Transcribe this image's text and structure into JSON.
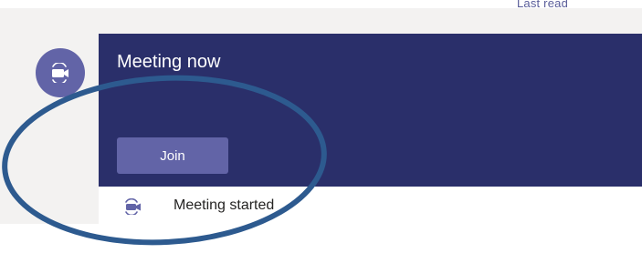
{
  "header": {
    "last_read": "Last read"
  },
  "avatar": {
    "icon": "video-camera-icon"
  },
  "meeting_card": {
    "title": "Meeting now",
    "join_label": "Join",
    "status_text": "Meeting started",
    "status_icon": "video-camera-icon"
  },
  "annotation": {
    "shape": "ellipse",
    "color": "#2d5a8f"
  },
  "colors": {
    "card_header": "#2a2f6a",
    "accent": "#6264a7",
    "background": "#f3f2f1"
  }
}
